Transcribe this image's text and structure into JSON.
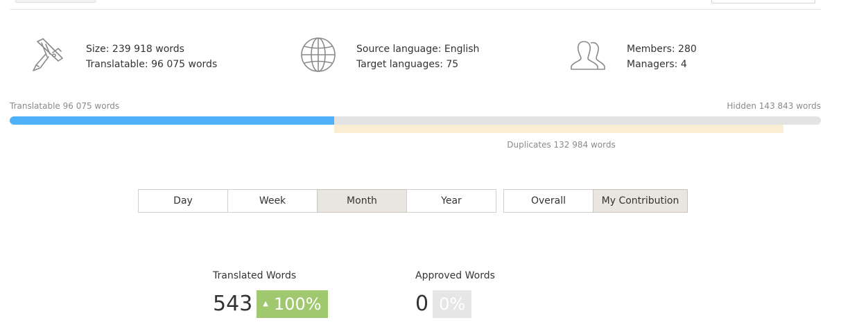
{
  "project_info": {
    "size": {
      "icon": "caliper-icon",
      "size_line": "Size: 239 918 words",
      "translatable_line": "Translatable: 96 075 words"
    },
    "languages": {
      "icon": "globe-icon",
      "source_line": "Source language: English",
      "target_line": "Target languages: 75"
    },
    "team": {
      "icon": "users-icon",
      "members_line": "Members: 280",
      "managers_line": "Managers: 4"
    }
  },
  "word_bar": {
    "translatable_label": "Translatable 96 075 words",
    "hidden_label": "Hidden 143 843 words",
    "duplicates_label": "Duplicates 132 984 words",
    "translatable_fraction": 0.4,
    "duplicates_fraction": 0.554,
    "colors": {
      "translatable": "#4fb2f8",
      "hidden": "#e3e3e3",
      "duplicates": "#f9eed4"
    }
  },
  "period_switch": {
    "options": [
      "Day",
      "Week",
      "Month",
      "Year"
    ],
    "selected": "Month"
  },
  "scope_switch": {
    "options": [
      "Overall",
      "My Contribution"
    ],
    "selected": "My Contribution"
  },
  "stats": {
    "translated": {
      "label": "Translated Words",
      "value": "543",
      "change": "100%",
      "trend_icon": "triangle-up-icon",
      "badge_color": "#a0c96f"
    },
    "approved": {
      "label": "Approved Words",
      "value": "0",
      "change": "0%",
      "badge_color": "#e6e6e6"
    }
  }
}
